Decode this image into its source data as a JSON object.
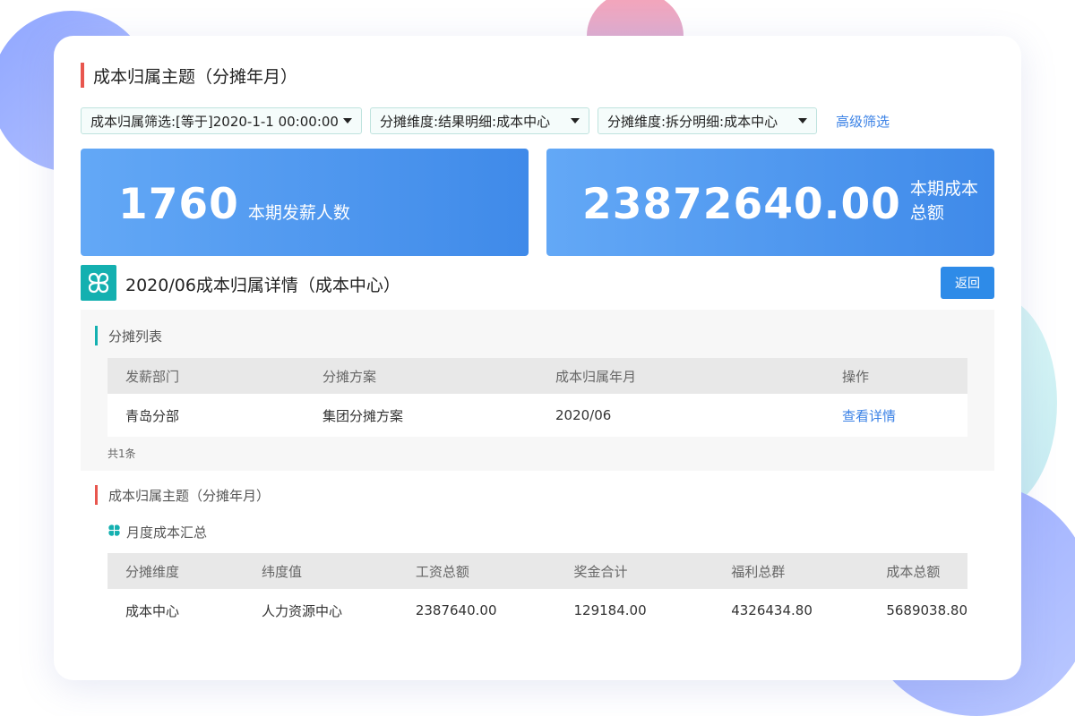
{
  "page": {
    "title": "成本归属主题（分摊年月）"
  },
  "filters": {
    "items": [
      {
        "label": "成本归属筛选:[等于]2020-1-1 00:00:00"
      },
      {
        "label": "分摊维度:结果明细:成本中心"
      },
      {
        "label": "分摊维度:拆分明细:成本中心"
      }
    ],
    "advanced_label": "高级筛选"
  },
  "stats": {
    "headcount": {
      "value": "1760",
      "label": "本期发薪人数"
    },
    "total_cost": {
      "value": "23872640.00",
      "label": "本期成本总额"
    }
  },
  "detail": {
    "title": "2020/06成本归属详情（成本中心）",
    "back_label": "返回"
  },
  "allocation_list": {
    "title": "分摊列表",
    "columns": [
      "发薪部门",
      "分摊方案",
      "成本归属年月",
      "操作"
    ],
    "rows": [
      {
        "dept": "青岛分部",
        "plan": "集团分摊方案",
        "period": "2020/06",
        "action": "查看详情"
      }
    ],
    "total_text": "共1条"
  },
  "summary": {
    "section_title": "成本归属主题（分摊年月）",
    "sub_title": "月度成本汇总",
    "columns": [
      "分摊维度",
      "纬度值",
      "工资总额",
      "奖金合计",
      "福利总群",
      "成本总额"
    ],
    "rows": [
      {
        "dimension": "成本中心",
        "value": "人力资源中心",
        "salary": "2387640.00",
        "bonus": "129184.00",
        "welfare": "4326434.80",
        "cost": "5689038.80"
      }
    ]
  },
  "colors": {
    "accent_blue": "#3b82e6",
    "accent_cyan": "#14b0b0",
    "accent_red": "#e8564e",
    "stat_gradient_start": "#63a8f6",
    "stat_gradient_end": "#3f8ae9"
  },
  "icons": {
    "logo": "clover-logo-icon",
    "sub_title": "clover-icon"
  }
}
